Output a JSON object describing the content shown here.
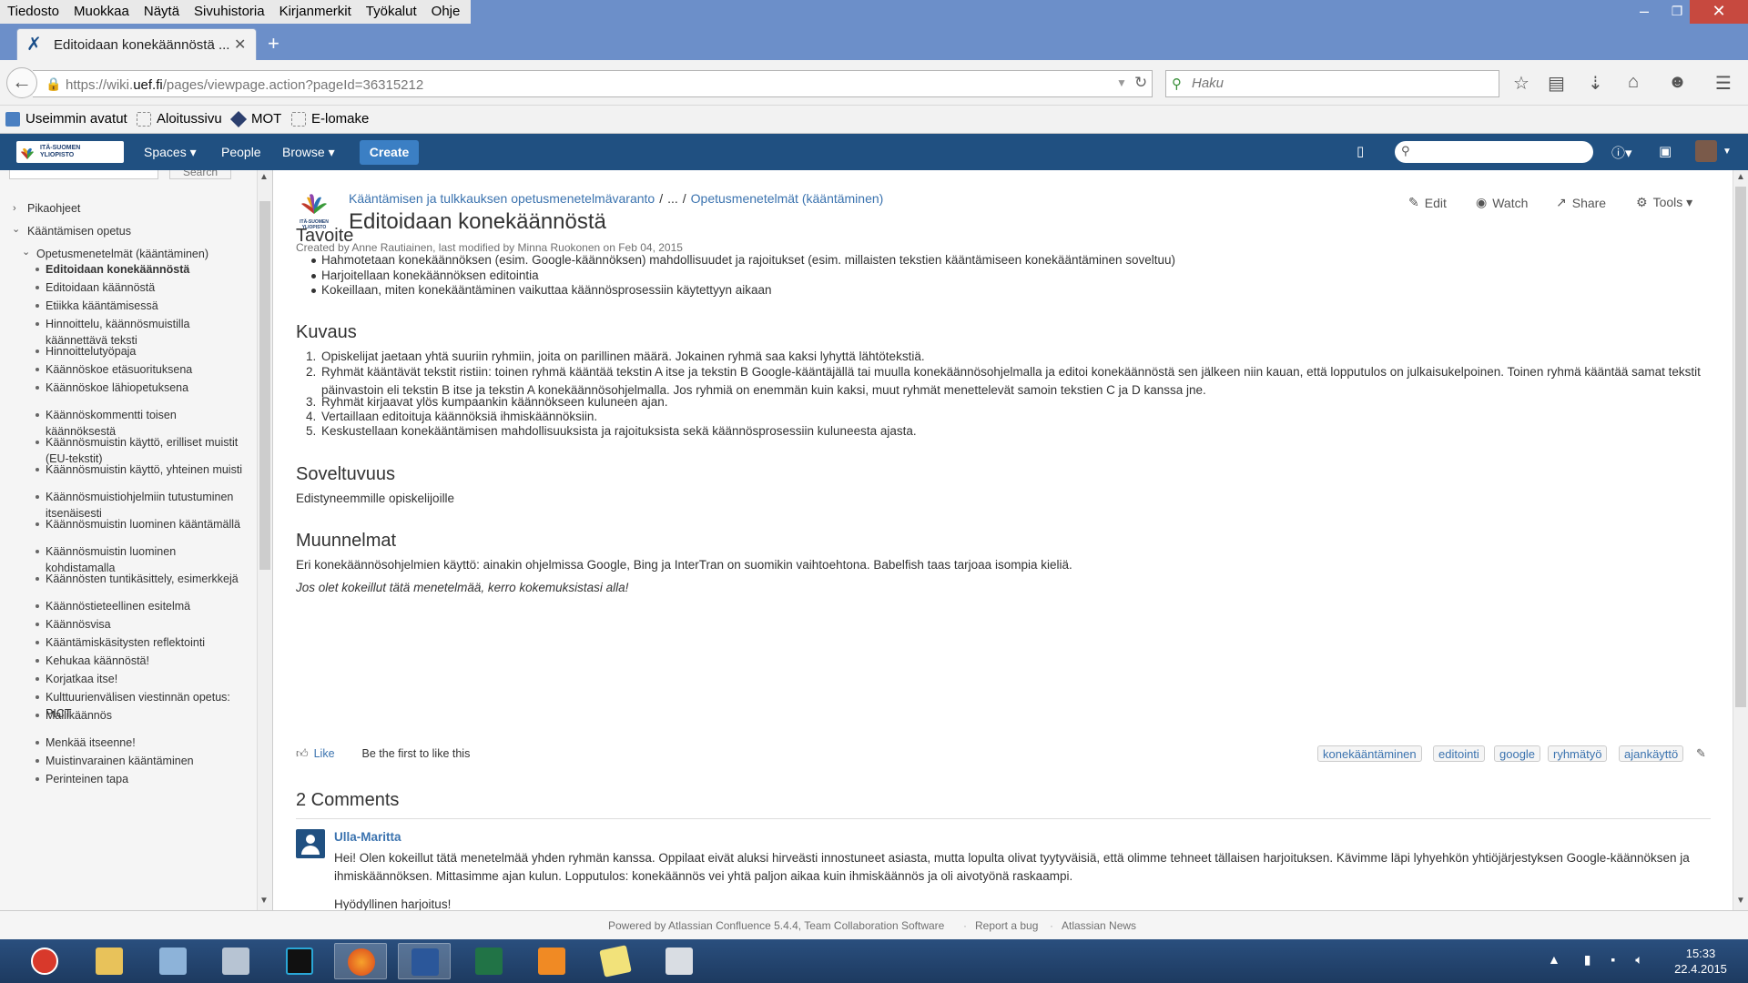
{
  "browser": {
    "menu": [
      "Tiedosto",
      "Muokkaa",
      "Näytä",
      "Sivuhistoria",
      "Kirjanmerkit",
      "Työkalut",
      "Ohje"
    ],
    "tab_title": "Editoidaan konekäännöstä ...",
    "url_prefix": "https://wiki.",
    "url_domain": "uef.fi",
    "url_path": "/pages/viewpage.action?pageId=36315212",
    "search_placeholder": "Haku",
    "bookmarks": [
      "Useimmin avatut",
      "Aloitussivu",
      "MOT",
      "E-lomake"
    ]
  },
  "confluence_header": {
    "logo_text_line1": "ITÄ-SUOMEN",
    "logo_text_line2": "YLIOPISTO",
    "nav": [
      "Spaces ▾",
      "People",
      "Browse ▾"
    ],
    "create_label": "Create"
  },
  "sidebar": {
    "search_button": "Search",
    "items": [
      {
        "label": "Pikaohjeet"
      },
      {
        "label": "Kääntämisen opetus"
      },
      {
        "label": "Opetusmenetelmät (kääntäminen)"
      },
      {
        "label": "Editoidaan konekäännöstä"
      },
      {
        "label": "Editoidaan käännöstä"
      },
      {
        "label": "Etiikka kääntämisessä"
      },
      {
        "label": "Hinnoittelu, käännösmuistilla käännettävä teksti"
      },
      {
        "label": "Hinnoittelutyöpaja"
      },
      {
        "label": "Käännöskoe etäsuorituksena"
      },
      {
        "label": "Käännöskoe lähiopetuksena"
      },
      {
        "label": "Käännöskommentti toisen käännöksestä"
      },
      {
        "label": "Käännösmuistin käyttö, erilliset muistit (EU-tekstit)"
      },
      {
        "label": "Käännösmuistin käyttö, yhteinen muisti"
      },
      {
        "label": "Käännösmuistiohjelmiin tutustuminen itsenäisesti"
      },
      {
        "label": "Käännösmuistin luominen kääntämällä"
      },
      {
        "label": "Käännösmuistin luominen kohdistamalla"
      },
      {
        "label": "Käännösten tuntikäsittely, esimerkkejä"
      },
      {
        "label": "Käännöstieteellinen esitelmä"
      },
      {
        "label": "Käännösvisa"
      },
      {
        "label": "Kääntämiskäsitysten reflektointi"
      },
      {
        "label": "Kehukaa käännöstä!"
      },
      {
        "label": "Korjatkaa itse!"
      },
      {
        "label": "Kulttuurienvälisen viestinnän opetus: PICT"
      },
      {
        "label": "Mallikäännös"
      },
      {
        "label": "Menkää itseenne!"
      },
      {
        "label": "Muistinvarainen kääntäminen"
      },
      {
        "label": "Perinteinen tapa"
      }
    ]
  },
  "page": {
    "breadcrumb": [
      "Kääntämisen ja tulkkauksen opetusmenetelmävaranto",
      "...",
      "Opetusmenetelmät (kääntäminen)"
    ],
    "title": "Editoidaan konekäännöstä",
    "meta": "Created by Anne Rautiainen, last modified by Minna Ruokonen on Feb 04, 2015",
    "actions": [
      "Edit",
      "Watch",
      "Share",
      "Tools ▾"
    ],
    "sections": {
      "tavoite_title": "Tavoite",
      "tavoite_items": [
        "Hahmotetaan konekäännöksen (esim. Google-käännöksen) mahdollisuudet ja rajoitukset (esim. millaisten tekstien kääntämiseen konekääntäminen soveltuu)",
        "Harjoitellaan konekäännöksen editointia",
        "Kokeillaan, miten konekääntäminen vaikuttaa käännösprosessiin käytettyyn aikaan"
      ],
      "kuvaus_title": "Kuvaus",
      "kuvaus_items": [
        "Opiskelijat jaetaan yhtä suuriin ryhmiin, joita on parillinen määrä. Jokainen ryhmä saa kaksi lyhyttä lähtötekstiä.",
        "Ryhmät kääntävät tekstit ristiin: toinen ryhmä kääntää tekstin A itse ja tekstin B Google-kääntäjällä tai muulla konekäännösohjelmalla ja editoi konekäännöstä sen jälkeen niin kauan, että lopputulos on julkaisukelpoinen. Toinen ryhmä kääntää samat tekstit päinvastoin eli tekstin B itse ja tekstin A konekäännösohjelmalla. Jos ryhmiä on enemmän kuin kaksi, muut ryhmät menettelevät samoin tekstien C ja D kanssa jne.",
        "Ryhmät kirjaavat ylös kumpaankin käännökseen kuluneen ajan.",
        "Vertaillaan editoituja käännöksiä ihmiskäännöksiin.",
        "Keskustellaan konekääntämisen mahdollisuuksista ja rajoituksista sekä käännösprosessiin kuluneesta ajasta."
      ],
      "soveltuvuus_title": "Soveltuvuus",
      "soveltuvuus_text": "Edistyneemmille opiskelijoille",
      "muunnelmat_title": "Muunnelmat",
      "muunnelmat_text": "Eri konekäännösohjelmien käyttö: ainakin ohjelmissa Google, Bing ja InterTran on suomikin vaihtoehtona. Babelfish taas tarjoaa isompia kieliä.",
      "muunnelmat_italic": "Jos olet kokeillut tätä menetelmää, kerro kokemuksistasi alla!"
    },
    "like_label": "Like",
    "like_text": "Be the first to like this",
    "labels": [
      "konekääntäminen",
      "editointi",
      "google",
      "ryhmätyö",
      "ajankäyttö"
    ],
    "comments_title": "2 Comments",
    "comment": {
      "author": "Ulla-Maritta",
      "text1": "Hei! Olen kokeillut tätä menetelmää yhden ryhmän kanssa. Oppilaat eivät aluksi hirveästi innostuneet asiasta, mutta lopulta olivat tyytyväisiä, että olimme tehneet tällaisen harjoituksen. Kävimme läpi lyhyehkön yhtiöjärjestyksen Google-käännöksen ja ihmiskäännöksen. Mittasimme ajan kulun. Lopputulos: konekäännös vei yhtä paljon aikaa kuin ihmiskäännös ja oli aivotyönä raskaampi.",
      "text2": "Hyödyllinen harjoitus!"
    }
  },
  "footer": {
    "powered": "Powered by Atlassian Confluence 5.4.4, Team Collaboration Software",
    "report": "Report a bug",
    "news": "Atlassian News"
  },
  "taskbar": {
    "time": "15:33",
    "date": "22.4.2015"
  },
  "colors": {
    "confluence_header": "#205081",
    "link": "#3b73af",
    "create_button": "#3b7fc4"
  }
}
